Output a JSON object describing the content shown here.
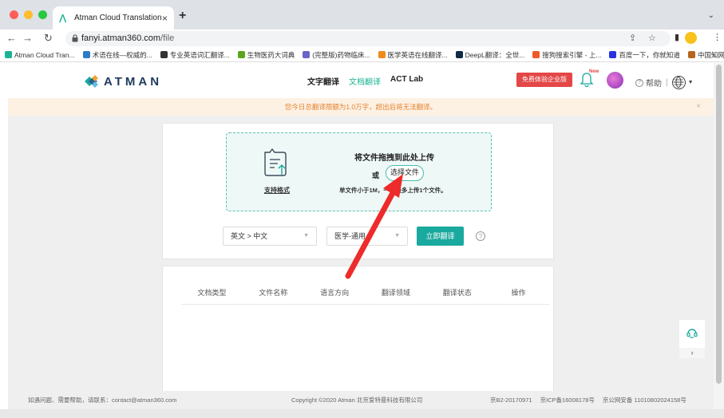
{
  "browser": {
    "tab_title": "Atman Cloud Translation",
    "url_host": "fanyi.atman360.com",
    "url_path": "/file",
    "bookmarks": [
      {
        "label": "Atman Cloud Tran...",
        "color": "#1ab394"
      },
      {
        "label": "术语在线—权威的...",
        "color": "#2d7ac9"
      },
      {
        "label": "专业英语词汇翻译...",
        "color": "#333333"
      },
      {
        "label": "生物医药大词典",
        "color": "#5aa51e"
      },
      {
        "label": "(完整版)药物临床...",
        "color": "#6b63c7"
      },
      {
        "label": "医学英语在线翻译...",
        "color": "#f08a1c"
      },
      {
        "label": "DeepL翻译：全世...",
        "color": "#0f2b46"
      },
      {
        "label": "搜狗搜索引擎 - 上...",
        "color": "#f15a24"
      },
      {
        "label": "百度一下，你就知道",
        "color": "#2932e1"
      },
      {
        "label": "中国知网",
        "color": "#b5651d"
      }
    ]
  },
  "header": {
    "logo_text": "ATMAN",
    "nav": [
      {
        "label": "文字翻译",
        "active": false
      },
      {
        "label": "文档翻译",
        "active": true
      },
      {
        "label": "ACT Lab",
        "active": false
      }
    ],
    "trial_button": "免费体验企业版",
    "new_badge": "New",
    "help_label": "帮助",
    "accent_color": "#1ab394"
  },
  "notice": {
    "text": "您今日总翻译限额为1.0万字，超出后将无法翻译。"
  },
  "upload": {
    "title": "将文件拖拽到此处上传",
    "or_text": "或",
    "choose_button": "选择文件",
    "formats_link": "支持格式",
    "limit_text": "单文件小于1M，一次最多上传1个文件。",
    "source_target": "英文 > 中文",
    "domain": "医学-通用",
    "translate_button": "立即翻译"
  },
  "table": {
    "columns": [
      "文档类型",
      "文件名称",
      "语言方向",
      "翻译领域",
      "翻译状态",
      "操作"
    ]
  },
  "footer": {
    "contact": "如遇问题、需要帮助，请联系：contact@atman360.com",
    "copyright": "Copyright ©2020 Atman   北京爱特曼科技有限公司",
    "icp1": "京B2-20170971",
    "icp2": "京ICP备16008178号",
    "icp3": "京公网安备 11010802024158号"
  }
}
